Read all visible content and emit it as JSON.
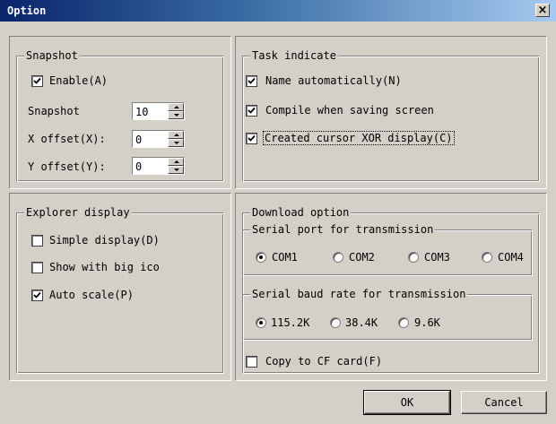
{
  "window": {
    "title": "Option",
    "close_glyph": "×"
  },
  "snapshot": {
    "legend": "Snapshot",
    "enable": {
      "label": "Enable(A)",
      "checked": true
    },
    "snapshot_label": "Snapshot",
    "snapshot_value": "10",
    "x_offset_label": "X offset(X):",
    "x_offset_value": "0",
    "y_offset_label": "Y offset(Y):",
    "y_offset_value": "0"
  },
  "task_indicate": {
    "legend": "Task indicate",
    "items": [
      {
        "label": "Name automatically(N)",
        "checked": true
      },
      {
        "label": "Compile when saving screen",
        "checked": true
      },
      {
        "label": "Created cursor XOR display(C)",
        "checked": true
      }
    ]
  },
  "explorer_display": {
    "legend": "Explorer display",
    "items": [
      {
        "label": "Simple display(D)",
        "checked": false
      },
      {
        "label": "Show with big ico",
        "checked": false
      },
      {
        "label": "Auto scale(P)",
        "checked": true
      }
    ]
  },
  "download_option": {
    "legend": "Download option",
    "serial_port": {
      "legend": "Serial port for transmission",
      "options": [
        "COM1",
        "COM2",
        "COM3",
        "COM4"
      ],
      "selected": "COM1"
    },
    "baud_rate": {
      "legend": "Serial baud rate for transmission",
      "options": [
        "115.2K",
        "38.4K",
        "9.6K"
      ],
      "selected": "115.2K"
    },
    "copy_cf": {
      "label": "Copy to CF card(F)",
      "checked": false
    }
  },
  "buttons": {
    "ok": "OK",
    "cancel": "Cancel"
  },
  "icons": {
    "close": "close-icon",
    "check": "checkmark-icon",
    "spin_up": "arrow-up-icon",
    "spin_down": "arrow-down-icon"
  },
  "colors": {
    "face": "#d4d0c8",
    "title_start": "#0a246a",
    "title_end": "#a6caf0"
  }
}
